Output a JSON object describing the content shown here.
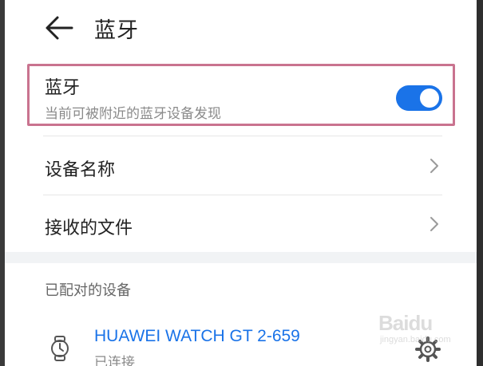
{
  "header": {
    "back_icon": "arrow-left-icon",
    "title": "蓝牙"
  },
  "bluetooth_toggle": {
    "title": "蓝牙",
    "subtitle": "当前可被附近的蓝牙设备发现",
    "enabled": true,
    "accent_color": "#1a73e8"
  },
  "settings": {
    "device_name_label": "设备名称",
    "received_files_label": "接收的文件"
  },
  "paired_section": {
    "heading": "已配对的设备",
    "devices": [
      {
        "name": "HUAWEI WATCH GT 2-659",
        "status": "已连接",
        "icon": "watch-icon",
        "settings_icon": "gear-icon"
      }
    ]
  },
  "watermark": {
    "brand": "Baidu",
    "url": "jingyan.baidu.com"
  },
  "colors": {
    "highlight_border": "#c9738f",
    "link_blue": "#1a73e8"
  }
}
